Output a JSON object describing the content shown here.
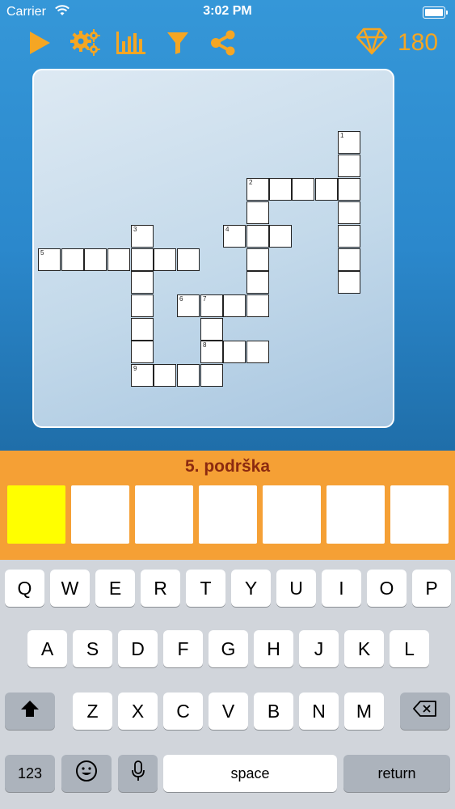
{
  "status_bar": {
    "carrier": "Carrier",
    "time": "3:02 PM"
  },
  "toolbar": {
    "icons": [
      "play-icon",
      "settings-gears-icon",
      "stats-chart-icon",
      "filter-icon",
      "share-icon",
      "diamond-icon"
    ],
    "gem_count": "180",
    "accent_color": "#f5a623"
  },
  "crossword": {
    "clue_numbers": [
      "1",
      "2",
      "3",
      "4",
      "5",
      "6",
      "7",
      "8",
      "9"
    ]
  },
  "clue": {
    "text": "5. podrška",
    "answer_box_count": 7,
    "active_index": 0
  },
  "keyboard": {
    "row1": [
      "Q",
      "W",
      "E",
      "R",
      "T",
      "Y",
      "U",
      "I",
      "O",
      "P"
    ],
    "row2": [
      "A",
      "S",
      "D",
      "F",
      "G",
      "H",
      "J",
      "K",
      "L"
    ],
    "row3": [
      "Z",
      "X",
      "C",
      "V",
      "B",
      "N",
      "M"
    ],
    "numbers_label": "123",
    "space_label": "space",
    "return_label": "return"
  }
}
